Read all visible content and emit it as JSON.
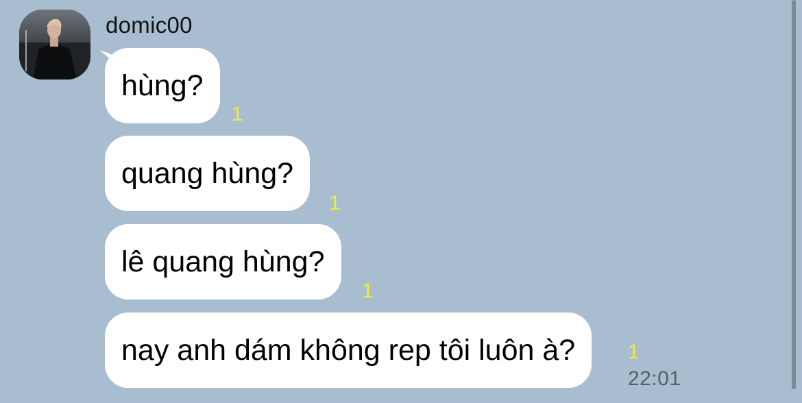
{
  "sender": {
    "name": "domic00",
    "avatar": "profile-photo"
  },
  "messages": [
    {
      "text": "hùng?",
      "unread": "1"
    },
    {
      "text": "quang hùng?",
      "unread": "1"
    },
    {
      "text": "lê quang hùng?",
      "unread": "1"
    },
    {
      "text": "nay anh dám không rep tôi luôn à?",
      "unread": "1"
    }
  ],
  "timestamp": "22:01",
  "colors": {
    "background": "#a9bdd0",
    "bubble": "#ffffff",
    "unread": "#f1ec3a",
    "timestamp": "#555f69"
  }
}
